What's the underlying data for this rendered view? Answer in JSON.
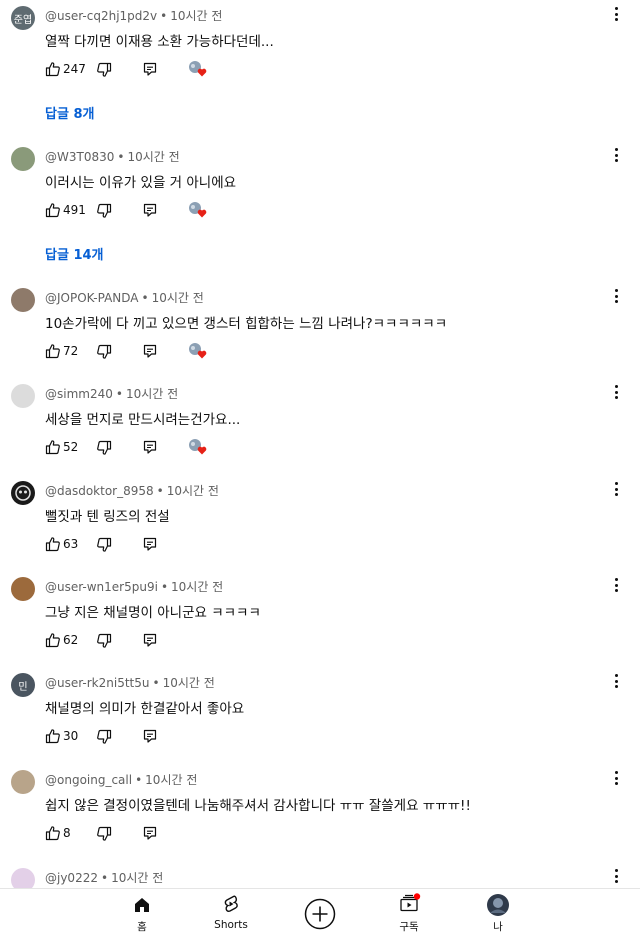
{
  "comments": [
    {
      "avatar_text": "준엽",
      "avatar_color": "#5f6b71",
      "author": "@user-cq2hj1pd2v",
      "time": "10시간 전",
      "text": "열짝 다끼면 이재용 소환 가능하다던데...",
      "likes": "247",
      "creator_heart": true
    },
    {
      "avatar_text": "",
      "avatar_color": "#8a9a7a",
      "author": "@W3T0830",
      "time": "10시간 전",
      "text": "이러시는 이유가 있을 거 아니에요",
      "likes": "491",
      "creator_heart": true
    },
    {
      "avatar_text": "",
      "avatar_color": "#8e7a6a",
      "author": "@JOPOK-PANDA",
      "time": "10시간 전",
      "text": "10손가락에 다 끼고 있으면 갱스터 힙합하는 느낌 나려나?ㅋㅋㅋㅋㅋㅋ",
      "likes": "72",
      "creator_heart": true
    },
    {
      "avatar_text": "",
      "avatar_color": "#dcdcdc",
      "author": "@simm240",
      "time": "10시간 전",
      "text": "세상을 먼지로 만드시려는건가요...",
      "likes": "52",
      "creator_heart": true
    },
    {
      "avatar_text": "",
      "avatar_color": "#1a1a1a",
      "author": "@dasdoktor_8958",
      "time": "10시간 전",
      "text": "뻘짓과 텐 링즈의 전설",
      "likes": "63",
      "creator_heart": false
    },
    {
      "avatar_text": "",
      "avatar_color": "#9c6a3c",
      "author": "@user-wn1er5pu9i",
      "time": "10시간 전",
      "text": "그냥 지은 채널명이 아니군요 ㅋㅋㅋㅋ",
      "likes": "62",
      "creator_heart": false
    },
    {
      "avatar_text": "민",
      "avatar_color": "#4a5560",
      "author": "@user-rk2ni5tt5u",
      "time": "10시간 전",
      "text": "채널명의 의미가 한결같아서 좋아요",
      "likes": "30",
      "creator_heart": false
    },
    {
      "avatar_text": "",
      "avatar_color": "#b8a48a",
      "author": "@ongoing_call",
      "time": "10시간 전",
      "text": "쉽지 않은 결정이였을텐데 나눔해주셔서 감사합니다 ㅠㅠ 잘쓸게요 ㅠㅠㅠ!!",
      "likes": "8",
      "creator_heart": false
    },
    {
      "avatar_text": "",
      "avatar_color": "#e3d0e8",
      "author": "@jy0222",
      "time": "10시간 전",
      "text": "",
      "likes": "",
      "creator_heart": false
    }
  ],
  "replies": [
    "답글 8개",
    "답글 14개"
  ],
  "nav": {
    "home": "홈",
    "shorts": "Shorts",
    "subscriptions": "구독",
    "me": "나"
  },
  "colors": {
    "link": "#065fd4",
    "meta": "#606060",
    "heart": "#e62117",
    "notification": "#ff0000"
  }
}
